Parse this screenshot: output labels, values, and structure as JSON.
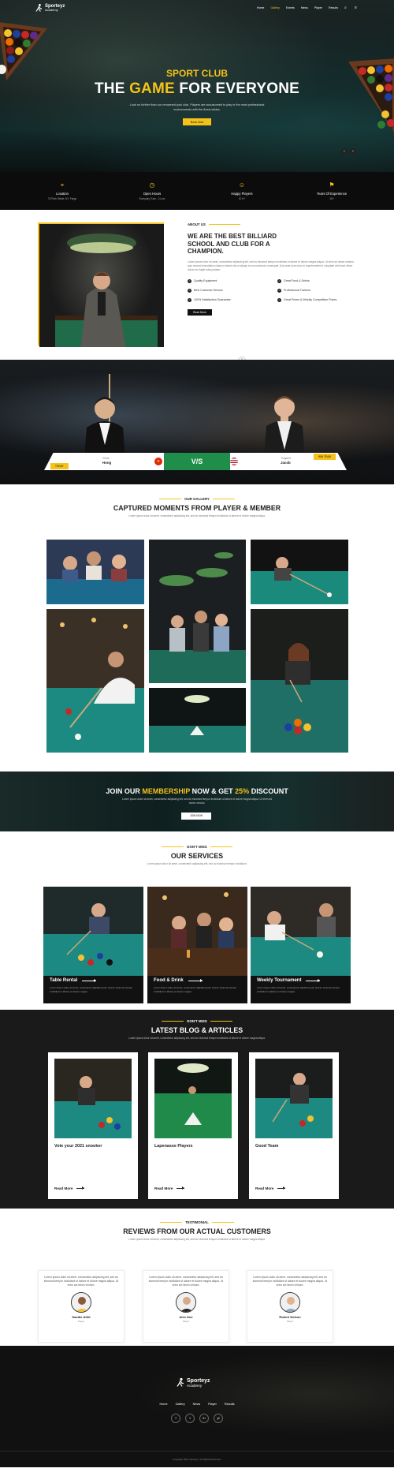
{
  "brand": {
    "name": "Sporteyz",
    "sub": "Academy"
  },
  "nav": {
    "items": [
      "Home",
      "Gallery",
      "Events",
      "News",
      "Player",
      "Results"
    ],
    "active_index": 1
  },
  "hero": {
    "kicker": "SPORT CLUB",
    "title_pre": "THE ",
    "title_highlight": "GAME",
    "title_post": " FOR EVERYONE",
    "subtitle": "Look no further than our renowned pool club. Players are accustomed to play in the most professional environments with the finest tables.",
    "button": "Book Now"
  },
  "info": [
    {
      "icon": "location-icon",
      "label": "Location",
      "value": "75 Park Street, NY, Fargo"
    },
    {
      "icon": "clock-icon",
      "label": "Open Hours",
      "value": "Everyday 9 am - 11 pm"
    },
    {
      "icon": "smile-icon",
      "label": "Happy Players",
      "value": "10 K+"
    },
    {
      "icon": "badge-icon",
      "label": "Years Of Experience",
      "value": "15+"
    }
  ],
  "about": {
    "kicker": "ABOUT US",
    "title": "WE ARE THE BEST BILLIARD SCHOOL AND CLUB FOR A CHAMPION.",
    "paragraph": "Lorem ipsum dolor sit amet, consectetur adipiscing elit, sed do eiusmod tempor incididunt ut labore et dolore magna aliqua. Ut enim ad minim veniam, quis nostrud exercitation ullamco laboris nisi ut aliquip ex ea commodo consequat. Duis aute irure dolor in reprehenderit in voluptate velit esse cillum dolore eu fugiat nulla pariatur.",
    "features": [
      "Quality Equipment",
      "Great Food & Drinks",
      "Best Customer Service",
      "Professional Trainers",
      "100% Satisfaction Guarantee",
      "Great Prizes & Weekly Competition Prizes"
    ],
    "button": "Read More"
  },
  "versus": {
    "left_country": "China",
    "left_name": "Hong",
    "left_tag": "TODAY",
    "center": "V/S",
    "right_country": "England",
    "right_name": "Jacob",
    "right_tag": "WIN TEAM"
  },
  "gallery": {
    "kicker": "OUR GALLERY",
    "title": "CAPTURED MOMENTS FROM PLAYER & MEMBER",
    "subtitle": "Lorem ipsum dolor sit amet, consectetur adipiscing elit, sed do eiusmod tempor incididunt ut labore et dolore magna aliqua."
  },
  "membership": {
    "pre": "JOIN OUR ",
    "highlight": "MEMBERSHIP",
    "mid": " NOW & GET ",
    "discount": "25%",
    "post": " DISCOUNT",
    "subtitle": "Lorem ipsum dolor sit amet, consectetur adipiscing elit, sed do eiusmod tempor incididunt ut labore et dolore magna aliqua. Ut enim ad minim veniam.",
    "button": "JOIN NOW"
  },
  "services": {
    "kicker": "DON'T MISS",
    "title": "OUR SERVICES",
    "subtitle": "Lorem ipsum dolor sit amet, consectetur adipiscing elit, sed do eiusmod tempor incididunt.",
    "items": [
      {
        "name": "Table Rental",
        "desc": "Lorem ipsum dolor sit amet, consectetur adipiscing elit, sed do eiusmod tempor incididunt ut labore et dolore magna."
      },
      {
        "name": "Food & Drink",
        "desc": "Lorem ipsum dolor sit amet, consectetur adipiscing elit, sed do eiusmod tempor incididunt ut labore et dolore magna."
      },
      {
        "name": "Weekly Tournament",
        "desc": "Lorem ipsum dolor sit amet, consectetur adipiscing elit, sed do eiusmod tempor incididunt ut labore et dolore magna."
      }
    ]
  },
  "blog": {
    "kicker": "DON'T MISS",
    "title": "LATEST BLOG & ARTICLES",
    "subtitle": "Lorem ipsum dolor sit amet, consectetur adipiscing elit, sed do eiusmod tempor incididunt ut labore et dolore magna aliqua.",
    "posts": [
      {
        "title": "Vote your 2021 snooker",
        "link": "Read More"
      },
      {
        "title": "Lapenasse Players",
        "link": "Read More"
      },
      {
        "title": "Good Team",
        "link": "Read More"
      }
    ]
  },
  "testimonials": {
    "kicker": "TESTIMONIAL",
    "title": "REVIEWS FROM OUR ACTUAL CUSTOMERS",
    "subtitle": "Lorem ipsum dolor sit amet, consectetur adipiscing elit, sed do eiusmod tempor incididunt ut labore et dolore magna aliqua.",
    "items": [
      {
        "quote": "Lorem ipsum dolor sit amet, consectetur adipiscing elit, sed do eiusmod tempor incididunt ut labore et dolore magna aliqua. Ut enim ad minim veniam.",
        "name": "Sandie Afint",
        "role": "Player"
      },
      {
        "quote": "Lorem ipsum dolor sit amet, consectetur adipiscing elit, sed do eiusmod tempor incididunt ut labore et dolore magna aliqua. Ut enim ad minim veniam.",
        "name": "Alex Doe",
        "role": "Player"
      },
      {
        "quote": "Lorem ipsum dolor sit amet, consectetur adipiscing elit, sed do eiusmod tempor incididunt ut labore et dolore magna aliqua. Ut enim ad minim veniam.",
        "name": "Robert Nelson",
        "role": "Player"
      }
    ]
  },
  "footer": {
    "nav": [
      "Home",
      "Gallery",
      "News",
      "Player",
      "Results"
    ],
    "social": [
      "f",
      "t",
      "in",
      "yt"
    ],
    "copyright": "Copyright 2021 Sporteyz. All Rights Reserved."
  },
  "colors": {
    "accent": "#f4c21a",
    "dark": "#111111",
    "felt": "#1d8a82"
  }
}
